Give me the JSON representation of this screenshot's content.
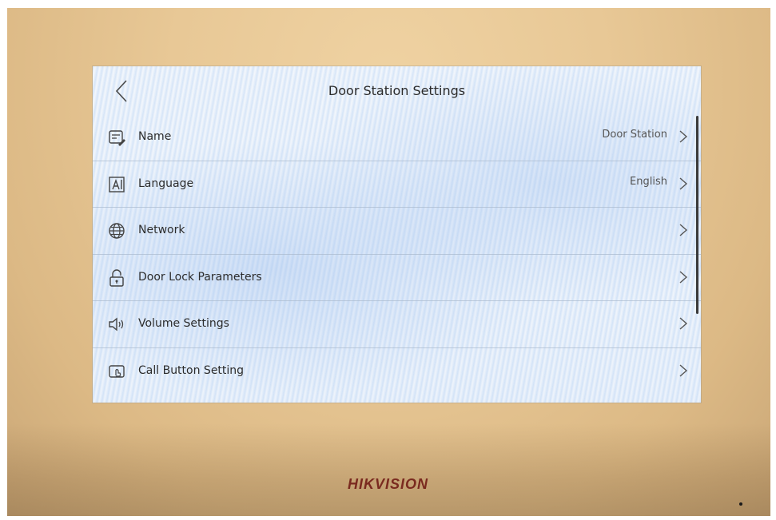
{
  "header": {
    "title": "Door Station Settings"
  },
  "items": [
    {
      "label": "Name",
      "value": "Door Station",
      "icon": "name-card-edit-icon"
    },
    {
      "label": "Language",
      "value": "English",
      "icon": "language-icon"
    },
    {
      "label": "Network",
      "value": "",
      "icon": "globe-icon"
    },
    {
      "label": "Door Lock Parameters",
      "value": "",
      "icon": "padlock-icon"
    },
    {
      "label": "Volume Settings",
      "value": "",
      "icon": "speaker-icon"
    },
    {
      "label": "Call Button Setting",
      "value": "",
      "icon": "call-button-icon"
    }
  ],
  "brand": {
    "logo": "HIKVISION",
    "logo_color": "#7a2a1f"
  },
  "colors": {
    "screen_bg": "#e6eef9",
    "device_bezel": "#e8c896",
    "text": "#2c2c2c"
  }
}
